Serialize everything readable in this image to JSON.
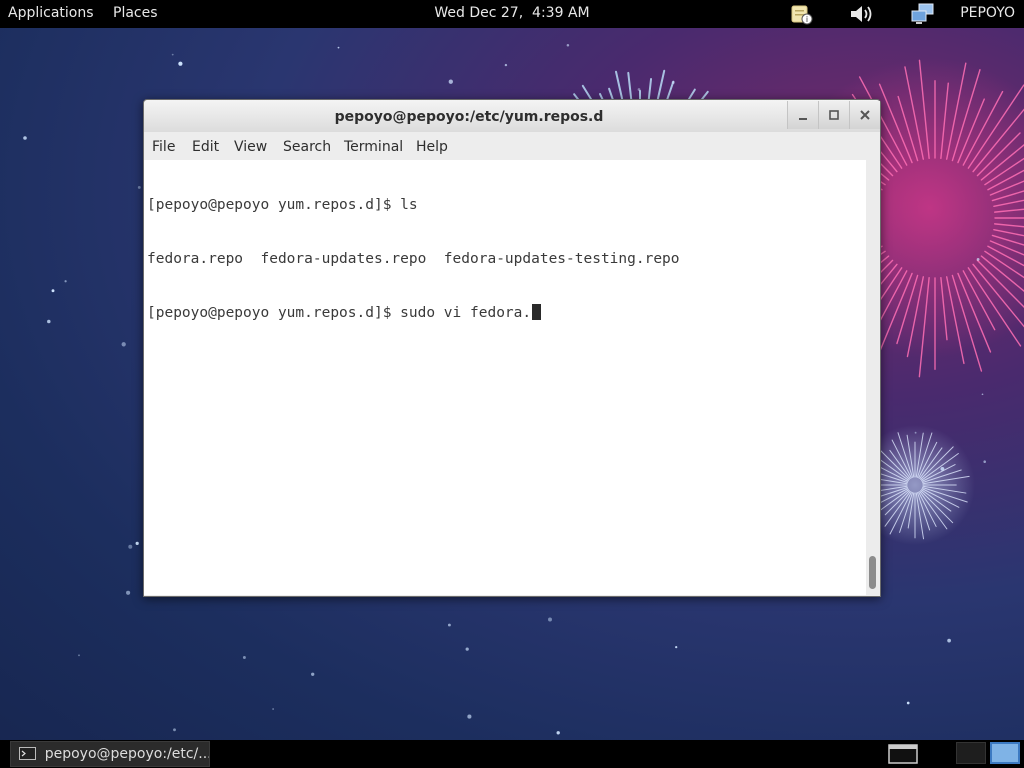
{
  "top_panel": {
    "applications": "Applications",
    "places": "Places",
    "clock": "Wed Dec 27,  4:39 AM",
    "user": "PEPOYO",
    "tray_icons": [
      "updates-icon",
      "volume-icon",
      "network-icon"
    ]
  },
  "window": {
    "title": "pepoyo@pepoyo:/etc/yum.repos.d",
    "menu": [
      "File",
      "Edit",
      "View",
      "Search",
      "Terminal",
      "Help"
    ],
    "terminal_lines": [
      "[pepoyo@pepoyo yum.repos.d]$ ls",
      "fedora.repo  fedora-updates.repo  fedora-updates-testing.repo",
      "[pepoyo@pepoyo yum.repos.d]$ sudo vi fedora."
    ],
    "scroll_position": 1.0
  },
  "taskbar": {
    "tasks": [
      {
        "label": "pepoyo@pepoyo:/etc/...",
        "icon": "terminal-icon"
      }
    ],
    "workspaces": 2,
    "active_workspace": 2
  },
  "colors": {
    "panel": "#000000",
    "terminal_bg": "#ffffff",
    "terminal_fg": "#3a3a3a",
    "workspace_active": "#7fb3e6"
  }
}
